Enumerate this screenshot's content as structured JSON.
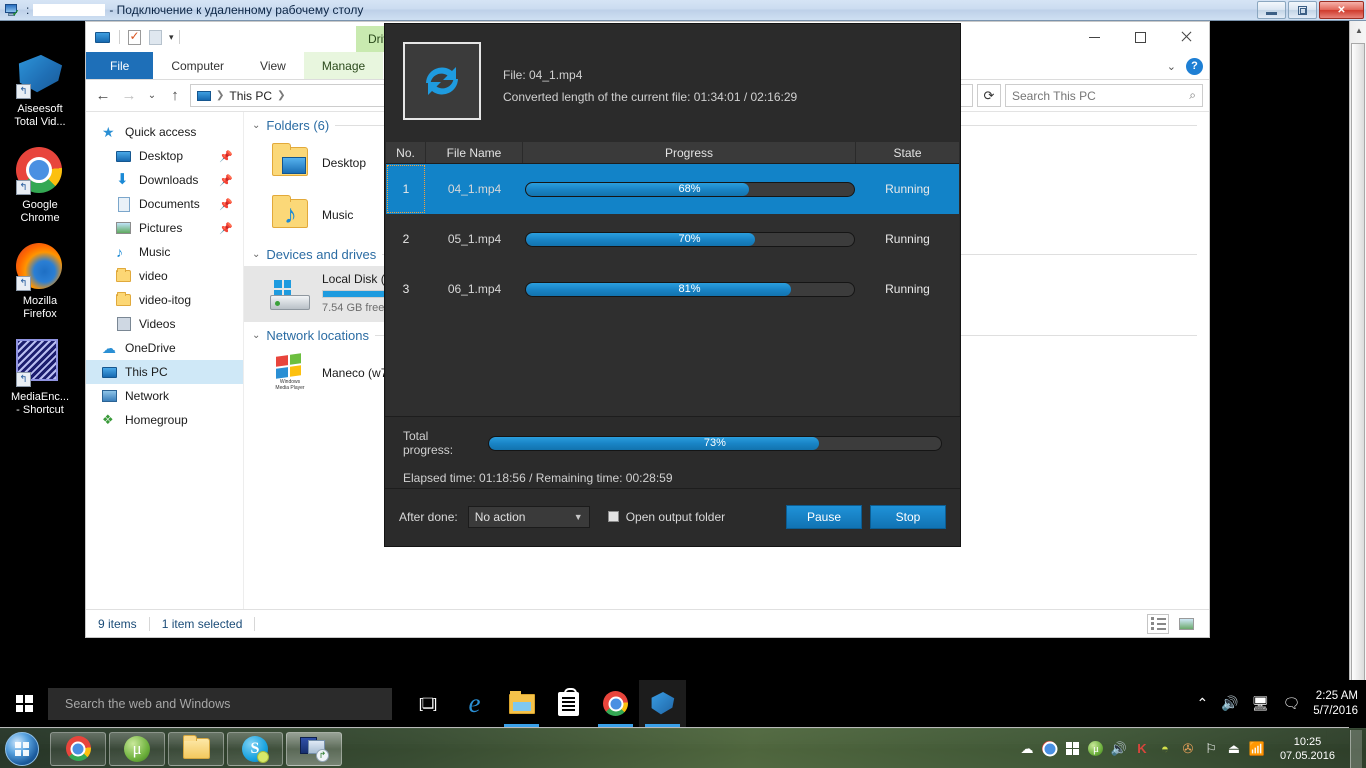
{
  "rdp": {
    "title_suffix": "- Подключение к удаленному рабочему столу",
    "icon": "remote-desktop-icon",
    "buttons": {
      "minimize": "minimize-icon",
      "restore": "restore-icon",
      "close": "close-icon"
    }
  },
  "desktop_icons": [
    {
      "label": "Aiseesoft\nTotal Vid...",
      "icon": "film-reel-icon"
    },
    {
      "label": "Google\nChrome",
      "icon": "chrome-icon"
    },
    {
      "label": "Mozilla\nFirefox",
      "icon": "firefox-icon"
    },
    {
      "label": "MediaEnc...\n- Shortcut",
      "icon": "media-encoder-icon"
    }
  ],
  "explorer": {
    "quick_access_title": "This PC",
    "contextual_tab": "Drive Tools",
    "ribbon_tabs": [
      "File",
      "Computer",
      "View",
      "Manage"
    ],
    "help_icon": "help-icon",
    "chevron_icon": "chevron-down-icon",
    "address": {
      "root_icon": "this-pc-icon",
      "crumb": "This PC"
    },
    "refresh_icon": "refresh-icon",
    "search": {
      "placeholder": "Search This PC",
      "icon": "search-icon"
    },
    "nav": [
      {
        "label": "Quick access",
        "icon": "star-icon",
        "indent": false,
        "pinned": false,
        "selected": false
      },
      {
        "label": "Desktop",
        "icon": "desktop-monitor-icon",
        "indent": true,
        "pinned": true,
        "selected": false
      },
      {
        "label": "Downloads",
        "icon": "download-arrow-icon",
        "indent": true,
        "pinned": true,
        "selected": false
      },
      {
        "label": "Documents",
        "icon": "document-icon",
        "indent": true,
        "pinned": true,
        "selected": false
      },
      {
        "label": "Pictures",
        "icon": "picture-icon",
        "indent": true,
        "pinned": true,
        "selected": false
      },
      {
        "label": "Music",
        "icon": "music-note-icon",
        "indent": true,
        "pinned": false,
        "selected": false
      },
      {
        "label": "video",
        "icon": "folder-icon",
        "indent": true,
        "pinned": false,
        "selected": false
      },
      {
        "label": "video-itog",
        "icon": "folder-icon",
        "indent": true,
        "pinned": false,
        "selected": false
      },
      {
        "label": "Videos",
        "icon": "videos-folder-icon",
        "indent": true,
        "pinned": false,
        "selected": false
      },
      {
        "label": "OneDrive",
        "icon": "cloud-icon",
        "indent": false,
        "pinned": false,
        "selected": false
      },
      {
        "label": "This PC",
        "icon": "this-pc-icon",
        "indent": false,
        "pinned": false,
        "selected": true
      },
      {
        "label": "Network",
        "icon": "network-icon",
        "indent": false,
        "pinned": false,
        "selected": false
      },
      {
        "label": "Homegroup",
        "icon": "homegroup-icon",
        "indent": false,
        "pinned": false,
        "selected": false
      }
    ],
    "groups": {
      "folders_header": "Folders (6)",
      "folders": [
        {
          "label": "Desktop",
          "icon": "desktop-folder-icon"
        },
        {
          "label": "Music",
          "icon": "music-folder-icon"
        }
      ],
      "devices_header": "Devices and drives",
      "drive": {
        "name": "Local Disk (C",
        "free": "7.54 GB free",
        "fill_percent": 62,
        "icon": "hard-drive-icon"
      },
      "network_header": "Network locations",
      "network": {
        "label": "Maneco (w7",
        "icon": "windows-media-player-icon"
      }
    },
    "status": {
      "items": "9 items",
      "selection": "1 item selected"
    },
    "view_buttons": [
      {
        "name": "details-view-button",
        "active": true
      },
      {
        "name": "large-icons-view-button",
        "active": false
      }
    ],
    "window_buttons": {
      "minimize": "minimize-icon",
      "maximize": "maximize-icon",
      "close": "close-icon"
    }
  },
  "converter": {
    "logo_icon": "convert-refresh-icon",
    "file_line": "File: 04_1.mp4",
    "converted_line": "Converted length of the current file: 01:34:01 / 02:16:29",
    "columns": [
      "No.",
      "File Name",
      "Progress",
      "State"
    ],
    "rows": [
      {
        "no": "1",
        "file": "04_1.mp4",
        "percent": 68,
        "percent_label": "68%",
        "state": "Running",
        "selected": true
      },
      {
        "no": "2",
        "file": "05_1.mp4",
        "percent": 70,
        "percent_label": "70%",
        "state": "Running",
        "selected": false
      },
      {
        "no": "3",
        "file": "06_1.mp4",
        "percent": 81,
        "percent_label": "81%",
        "state": "Running",
        "selected": false
      }
    ],
    "total_label": "Total progress:",
    "total_percent": 73,
    "total_percent_label": "73%",
    "elapsed_line": "Elapsed time: 01:18:56 / Remaining time: 00:28:59",
    "after_done_label": "After done:",
    "after_done_value": "No action",
    "after_done_caret": "chevron-down-icon",
    "open_output_label": "Open output folder",
    "open_output_checked": false,
    "pause_label": "Pause",
    "stop_label": "Stop",
    "accent": "#1283c8"
  },
  "guest_taskbar": {
    "start_icon": "windows-logo-icon",
    "search_placeholder": "Search the web and Windows",
    "items": [
      {
        "name": "task-view-icon",
        "active": false
      },
      {
        "name": "edge-icon",
        "active": false
      },
      {
        "name": "file-explorer-icon",
        "active": true
      },
      {
        "name": "store-icon",
        "active": false
      },
      {
        "name": "chrome-icon",
        "active": true
      },
      {
        "name": "aiseesoft-converter-icon",
        "active": true
      }
    ],
    "tray": [
      "show-hidden-icons-icon",
      "volume-icon",
      "network-icon",
      "action-center-icon"
    ],
    "clock_time": "2:25 AM",
    "clock_date": "5/7/2016"
  },
  "host_taskbar": {
    "start_icon": "windows-7-orb-icon",
    "items": [
      {
        "name": "chrome-icon",
        "active": false
      },
      {
        "name": "utorrent-icon",
        "active": false
      },
      {
        "name": "file-explorer-icon",
        "active": false
      },
      {
        "name": "skype-icon",
        "active": false
      },
      {
        "name": "remote-desktop-icon",
        "active": true
      }
    ],
    "tray": [
      "dropbox-icon",
      "chrome-icon",
      "windows-icon",
      "utorrent-icon",
      "volume-icon",
      "kaspersky-icon",
      "lemon-icon",
      "sound-mixer-icon",
      "flag-icon",
      "safely-remove-icon",
      "network-icon"
    ],
    "clock_time": "10:25",
    "clock_date": "07.05.2016"
  }
}
